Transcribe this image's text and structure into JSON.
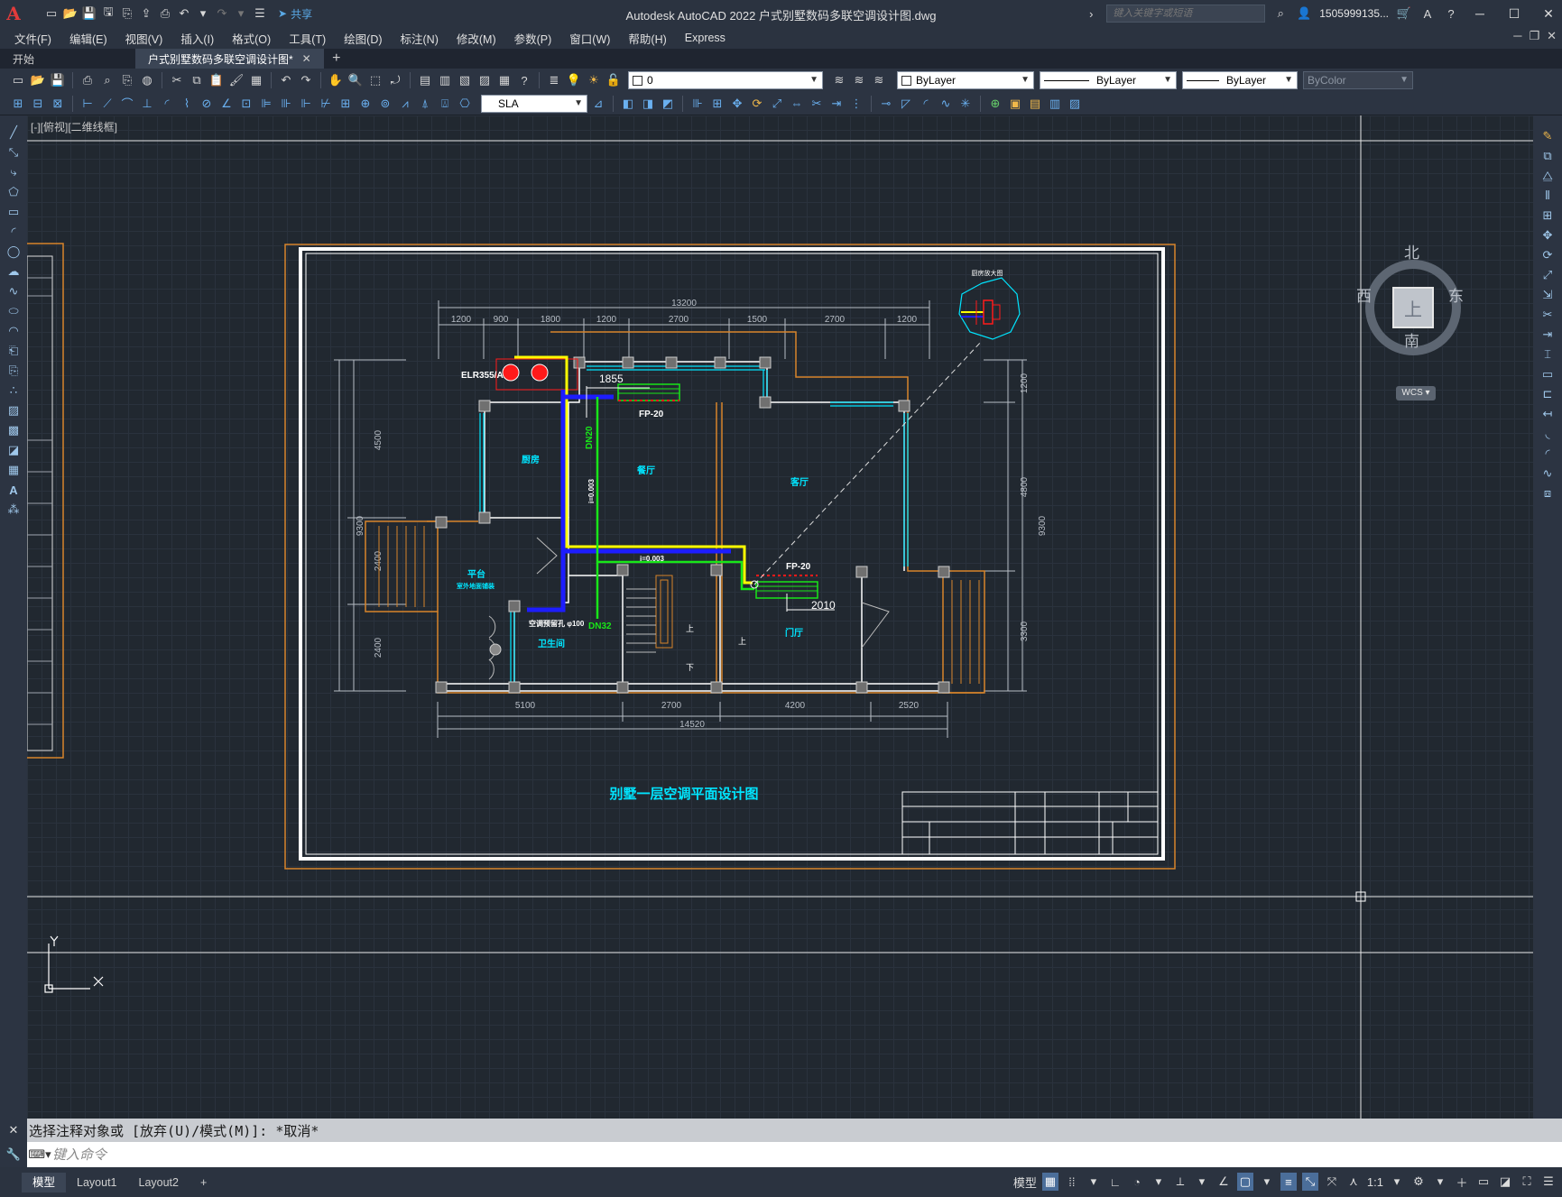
{
  "app": {
    "logo": "A",
    "title": "Autodesk AutoCAD 2022    户式别墅数码多联空调设计图.dwg",
    "share_label": "共享",
    "search_placeholder": "键入关键字或短语",
    "user": "1505999135...",
    "help": "?"
  },
  "menu": [
    "文件(F)",
    "编辑(E)",
    "视图(V)",
    "插入(I)",
    "格式(O)",
    "工具(T)",
    "绘图(D)",
    "标注(N)",
    "修改(M)",
    "参数(P)",
    "窗口(W)",
    "帮助(H)",
    "Express"
  ],
  "tabs": [
    {
      "label": "开始"
    },
    {
      "label": "户式别墅数码多联空调设计图*"
    }
  ],
  "toolbar": {
    "layer_value": "0",
    "color_value": "ByLayer",
    "linetype_value": "ByLayer",
    "lineweight_value": "ByLayer",
    "plotstyle_value": "ByColor",
    "style_value": "SLA"
  },
  "viewport": {
    "label": "[-][俯视][二维线框]"
  },
  "viewcube": {
    "north": "北",
    "south": "南",
    "east": "东",
    "west": "西",
    "face": "上",
    "wcs": "WCS"
  },
  "drawing": {
    "title": "别墅一层空调平面设计图",
    "detail_title": "厨房放大图",
    "unit_label": "ELR355/A",
    "fp_label_1": "FP-20",
    "fp_label_2": "FP-20",
    "dn32": "DN32",
    "dn20": "DN20",
    "slope_1": "i=0.003",
    "slope_2": "i=0.003",
    "pipe_note": "空调预留孔 φ100",
    "dim_1855": "1855",
    "dim_2010": "2010",
    "rooms": {
      "kitchen": "厨房",
      "dining": "餐厅",
      "living": "客厅",
      "platform": "平台",
      "platform_sub": "室外地面铺装",
      "bathroom": "卫生间",
      "entrance": "门厅",
      "up1": "上",
      "up2": "上",
      "down": "下"
    },
    "top_dims": [
      "1200",
      "900",
      "1800",
      "1200",
      "2700",
      "1500",
      "2700",
      "1200"
    ],
    "top_total": "13200",
    "bottom_dims": [
      "5100",
      "2700",
      "4200",
      "2520"
    ],
    "bottom_total": "14520",
    "left_dims": [
      "4500",
      "2400",
      "2400"
    ],
    "left_total": "9300",
    "right_dims": [
      "1200",
      "4800",
      "3300"
    ],
    "right_total": "9300"
  },
  "command": {
    "history": "选择注释对象或 [放弃(U)/模式(M)]: *取消*",
    "placeholder": "键入命令"
  },
  "layout_tabs": [
    "模型",
    "Layout1",
    "Layout2"
  ],
  "status": {
    "model_label": "模型",
    "scale": "1:1"
  },
  "colors": {
    "background": "#212830",
    "frame_orange": "#d8842a",
    "cyan": "#00e5ff",
    "supply_yellow": "#ffff00",
    "condensate_green": "#19e619",
    "refrigerant_blue": "#1d1dff",
    "unit_red": "#ff1a1a"
  }
}
